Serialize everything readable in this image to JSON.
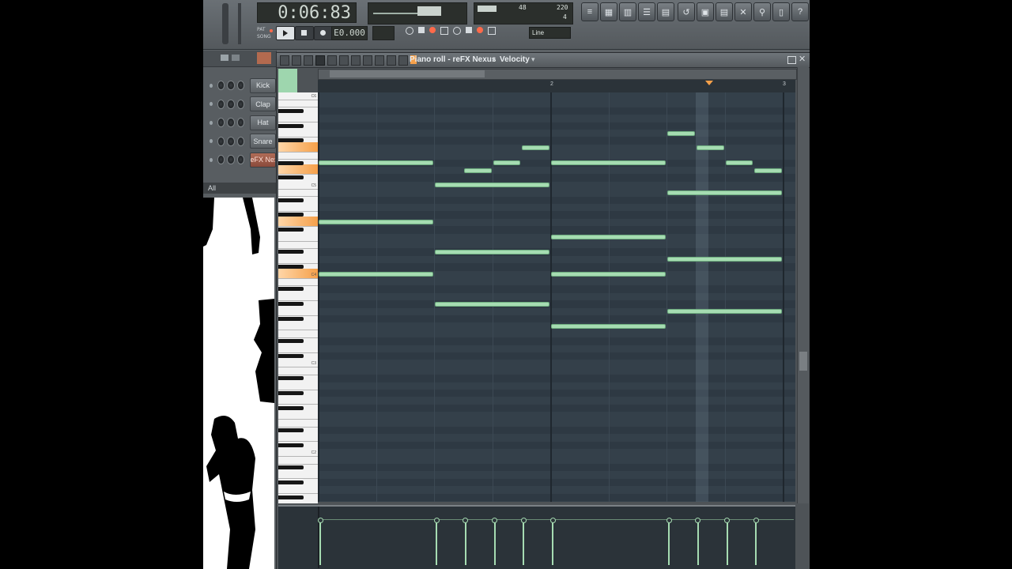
{
  "transport": {
    "time": "0:06:83",
    "tempo_display": "E0.000",
    "pat_label": "PAT",
    "song_label": "SONG",
    "snap_mode": "Line",
    "cpu_value": "48",
    "poly_value": "220",
    "poly_sub": "4"
  },
  "channels": [
    {
      "name": "Kick"
    },
    {
      "name": "Clap"
    },
    {
      "name": "Hat"
    },
    {
      "name": "Snare"
    },
    {
      "name": "reFX Nex"
    }
  ],
  "channel_filter": "All",
  "piano_roll": {
    "title": "Piano roll - reFX Nexus",
    "event_target": "Velocity",
    "ruler_marks": [
      "2",
      "3"
    ],
    "octave_labels": [
      "C6",
      "C5",
      "C4",
      "C3",
      "C2"
    ]
  },
  "notes": [
    {
      "start": 0,
      "length": 2,
      "pitch": 75
    },
    {
      "start": 0,
      "length": 2,
      "pitch": 67
    },
    {
      "start": 0,
      "length": 2,
      "pitch": 60
    },
    {
      "start": 2,
      "length": 2,
      "pitch": 72
    },
    {
      "start": 2,
      "length": 2,
      "pitch": 63
    },
    {
      "start": 2,
      "length": 2,
      "pitch": 56
    },
    {
      "start": 2.5,
      "length": 0.5,
      "pitch": 74
    },
    {
      "start": 3,
      "length": 0.5,
      "pitch": 75
    },
    {
      "start": 3.5,
      "length": 0.5,
      "pitch": 77
    },
    {
      "start": 4,
      "length": 2,
      "pitch": 75
    },
    {
      "start": 4,
      "length": 2,
      "pitch": 65
    },
    {
      "start": 4,
      "length": 2,
      "pitch": 60
    },
    {
      "start": 4,
      "length": 2,
      "pitch": 53
    },
    {
      "start": 6,
      "length": 0.5,
      "pitch": 79
    },
    {
      "start": 6.5,
      "length": 0.5,
      "pitch": 77
    },
    {
      "start": 7,
      "length": 0.5,
      "pitch": 75
    },
    {
      "start": 7.5,
      "length": 0.5,
      "pitch": 74
    },
    {
      "start": 6,
      "length": 2,
      "pitch": 71
    },
    {
      "start": 6,
      "length": 2,
      "pitch": 62
    },
    {
      "start": 6,
      "length": 2,
      "pitch": 55
    }
  ],
  "velocity_stems": [
    0,
    2,
    2.5,
    3,
    3.5,
    4,
    6,
    6.5,
    7,
    7.5
  ]
}
